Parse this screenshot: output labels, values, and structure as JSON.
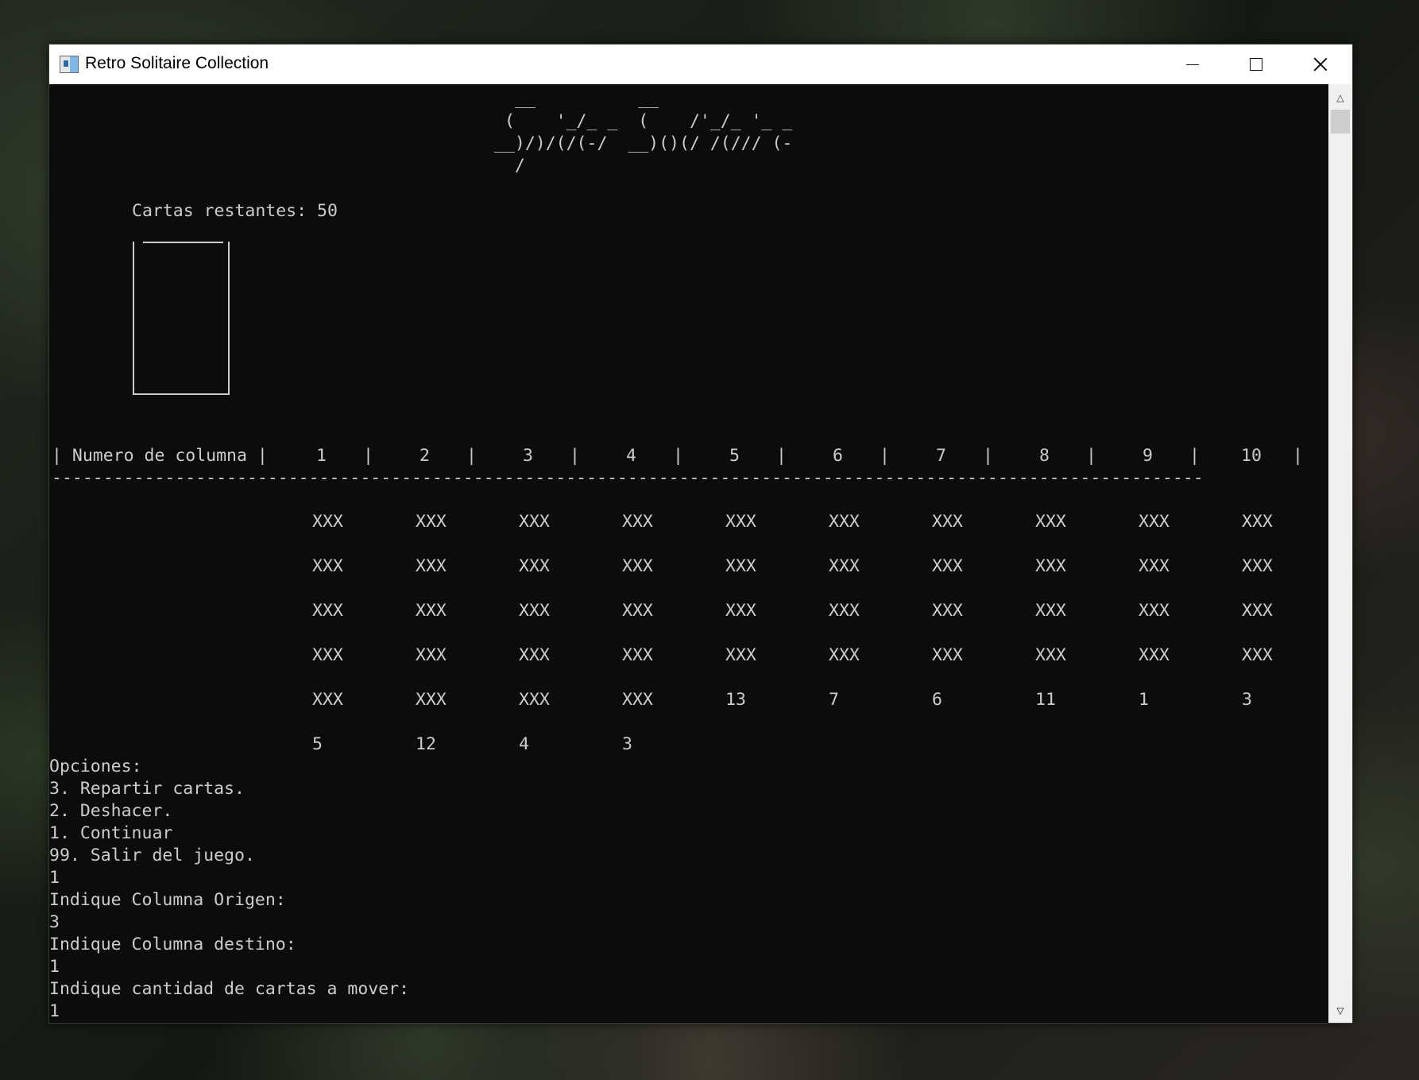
{
  "window": {
    "title": "Retro Solitaire Collection"
  },
  "banner": {
    "line1": "  __          __",
    "line2": " (    '_/_ _  (    /'_/_ '_ _",
    "line3": "__)/)/(/(-/  __)()(/ /(/// (-",
    "line4": "  /"
  },
  "deck": {
    "remaining_label": "Cartas restantes: 50"
  },
  "table": {
    "header_label": "| Numero de columna |",
    "column_numbers": [
      "1",
      "2",
      "3",
      "4",
      "5",
      "6",
      "7",
      "8",
      "9",
      "10"
    ],
    "separator_char": "|",
    "divider": "----------------------------------------------------------------------------------------------------------------",
    "rows": [
      [
        "XXX",
        "XXX",
        "XXX",
        "XXX",
        "XXX",
        "XXX",
        "XXX",
        "XXX",
        "XXX",
        "XXX"
      ],
      [
        "XXX",
        "XXX",
        "XXX",
        "XXX",
        "XXX",
        "XXX",
        "XXX",
        "XXX",
        "XXX",
        "XXX"
      ],
      [
        "XXX",
        "XXX",
        "XXX",
        "XXX",
        "XXX",
        "XXX",
        "XXX",
        "XXX",
        "XXX",
        "XXX"
      ],
      [
        "XXX",
        "XXX",
        "XXX",
        "XXX",
        "XXX",
        "XXX",
        "XXX",
        "XXX",
        "XXX",
        "XXX"
      ],
      [
        "XXX",
        "XXX",
        "XXX",
        "XXX",
        "13",
        "7",
        "6",
        "11",
        "1",
        "3"
      ],
      [
        "5",
        "12",
        "4",
        "3",
        "",
        "",
        "",
        "",
        "",
        ""
      ]
    ]
  },
  "console_lines": [
    "Opciones:",
    "3. Repartir cartas.",
    "2. Deshacer.",
    "1. Continuar",
    "99. Salir del juego.",
    "1",
    "Indique Columna Origen:",
    "3",
    "Indique Columna destino:",
    "1",
    "Indique cantidad de cartas a mover:",
    "1"
  ],
  "icons": {
    "app": "terminal-app-icon",
    "minimize": "minimize-icon",
    "maximize": "maximize-icon",
    "close": "close-icon",
    "scroll_up": "scroll-up-arrow-icon",
    "scroll_down": "scroll-down-arrow-icon"
  },
  "colors": {
    "console_bg": "#0c0c0c",
    "console_fg": "#cccccc",
    "titlebar_bg": "#ffffff"
  }
}
